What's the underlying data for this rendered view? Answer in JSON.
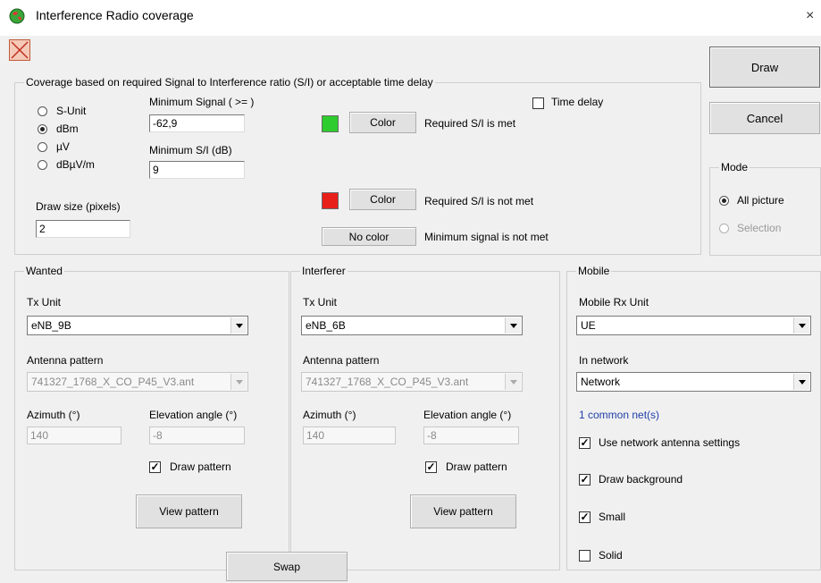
{
  "window": {
    "title": "Interference Radio coverage",
    "close_glyph": "×"
  },
  "actions": {
    "draw": "Draw",
    "cancel": "Cancel",
    "swap": "Swap"
  },
  "coverage": {
    "legend": "Coverage based on  required Signal to Interference ratio (S/I) or acceptable time delay",
    "units": [
      "S-Unit",
      "dBm",
      "µV",
      "dBµV/m"
    ],
    "selected_unit": "dBm",
    "min_signal_label": "Minimum Signal ( >= )",
    "min_signal_value": "-62,9",
    "min_si_label": "Minimum S/I (dB)",
    "min_si_value": "9",
    "draw_size_label": "Draw size (pixels)",
    "draw_size_value": "2",
    "time_delay_label": "Time delay",
    "time_delay_checked": false,
    "color_button": "Color",
    "no_color_button": "No color",
    "met_label": "Required S/I is met",
    "not_met_label": "Required S/I is not met",
    "min_not_met_label": "Minimum signal is not met",
    "met_color": "#2ecc2e",
    "not_met_color": "#e8201a"
  },
  "mode": {
    "legend": "Mode",
    "all_picture": "All picture",
    "selection": "Selection",
    "selected": "All picture"
  },
  "wanted": {
    "legend": "Wanted",
    "tx_unit_label": "Tx Unit",
    "tx_unit_value": "eNB_9B",
    "antenna_label": "Antenna pattern",
    "antenna_value": "741327_1768_X_CO_P45_V3.ant",
    "azimuth_label": "Azimuth (°)",
    "azimuth_value": "140",
    "elevation_label": "Elevation angle (°)",
    "elevation_value": "-8",
    "draw_pattern_label": "Draw pattern",
    "draw_pattern_checked": true,
    "view_pattern": "View pattern"
  },
  "interferer": {
    "legend": "Interferer",
    "tx_unit_label": "Tx Unit",
    "tx_unit_value": "eNB_6B",
    "antenna_label": "Antenna pattern",
    "antenna_value": "741327_1768_X_CO_P45_V3.ant",
    "azimuth_label": "Azimuth (°)",
    "azimuth_value": "140",
    "elevation_label": "Elevation angle (°)",
    "elevation_value": "-8",
    "draw_pattern_label": "Draw pattern",
    "draw_pattern_checked": true,
    "view_pattern": "View pattern"
  },
  "mobile": {
    "legend": "Mobile",
    "rx_unit_label": "Mobile Rx Unit",
    "rx_unit_value": "UE",
    "network_label": "In network",
    "network_value": "Network",
    "common_nets": "1 common net(s)",
    "use_antenna_label": "Use network antenna settings",
    "use_antenna_checked": true,
    "draw_background_label": "Draw background",
    "draw_background_checked": true,
    "small_label": "Small",
    "small_checked": true,
    "solid_label": "Solid",
    "solid_checked": false
  },
  "icons": {
    "app": "app-globe-icon",
    "clear": "clear-x-icon",
    "close": "close-icon"
  },
  "check_glyph": "✓"
}
